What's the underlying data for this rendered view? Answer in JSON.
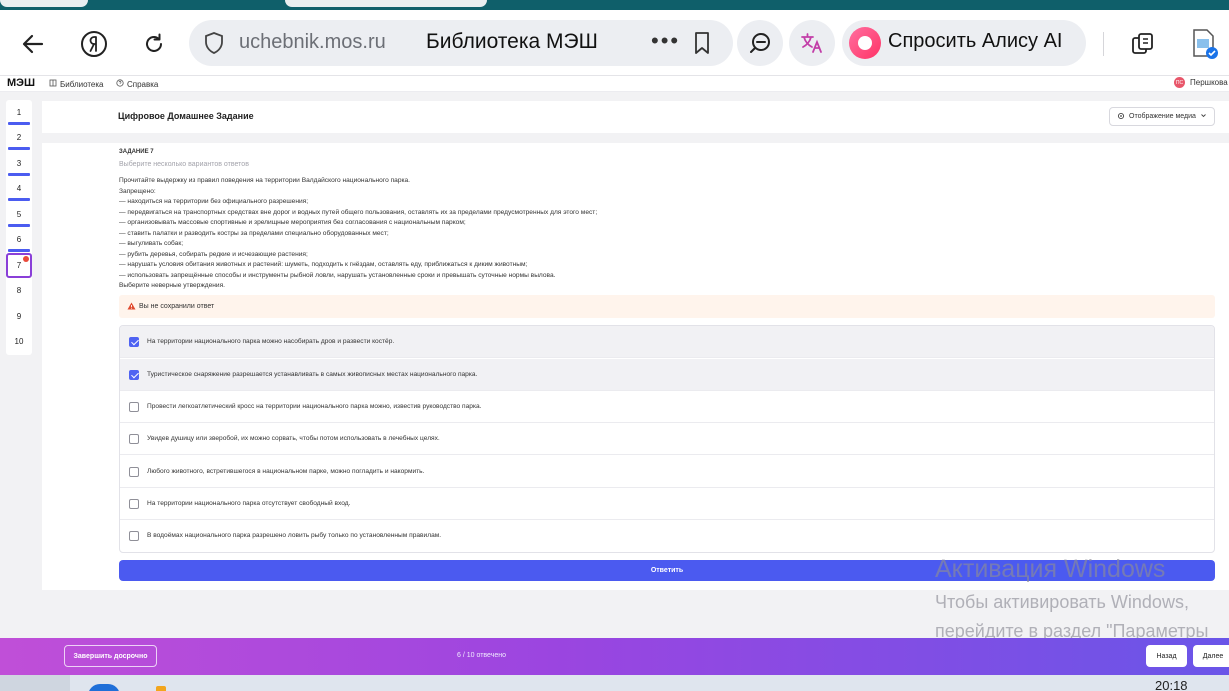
{
  "browser": {
    "host": "uchebnik.mos.ru",
    "page_title": "Библиотека МЭШ",
    "more": "•••",
    "alice_label": "Спросить Алису AI"
  },
  "site_header": {
    "logo": "МЭШ",
    "nav": [
      {
        "label": "Библиотека",
        "icon": "book-icon"
      },
      {
        "label": "Справка",
        "icon": "help-icon"
      }
    ],
    "user_name": "Першкова",
    "user_initials": "ПС"
  },
  "question_nav": [
    {
      "number": "1",
      "answered": true
    },
    {
      "number": "2",
      "answered": true
    },
    {
      "number": "3",
      "answered": true
    },
    {
      "number": "4",
      "answered": true
    },
    {
      "number": "5",
      "answered": true
    },
    {
      "number": "6",
      "answered": true
    },
    {
      "number": "7",
      "answered": false,
      "active": true,
      "warning": true
    },
    {
      "number": "8",
      "answered": false
    },
    {
      "number": "9",
      "answered": false
    },
    {
      "number": "10",
      "answered": false
    }
  ],
  "main": {
    "title": "Цифровое Домашнее Задание",
    "media_button": "Отображение медиа",
    "task_label": "ЗАДАНИЕ 7",
    "task_subtitle": "Выберите несколько вариантов ответов",
    "task_lines": [
      "Прочитайте выдержку из правил поведения на территории Валдайского национального парка.",
      "Запрещено:",
      "— находиться на территории без официального разрешения;",
      "— передвигаться на транспортных средствах вне дорог и водных путей общего пользования, оставлять их за пределами предусмотренных для этого мест;",
      "— организовывать массовые спортивные и зрелищные мероприятия без согласования с национальным парком;",
      "— ставить палатки и разводить костры за пределами специально оборудованных мест;",
      "— выгуливать собак;",
      "— рубить деревья, собирать редкие и исчезающие растения;",
      "— нарушать условия обитания животных и растений: шуметь, подходить к гнёздам, оставлять еду, приближаться к диким животным;",
      "— использовать запрещённые способы и инструменты рыбной ловли, нарушать установленные сроки и превышать суточные нормы вылова.",
      "Выберите неверные утверждения."
    ],
    "warning": "Вы не сохранили ответ",
    "options": [
      {
        "label": "На территории национального парка можно насобирать дров и развести костёр.",
        "checked": true
      },
      {
        "label": "Туристическое снаряжение разрешается устанавливать в самых живописных местах национального парка.",
        "checked": true
      },
      {
        "label": "Провести легкоатлетический кросс на территории национального парка можно, известив руководство парка.",
        "checked": false
      },
      {
        "label": "Увидев душицу или зверобой, их можно сорвать, чтобы потом использовать в лечебных целях.",
        "checked": false
      },
      {
        "label": "Любого животного, встретившегося в национальном парке, можно погладить и накормить.",
        "checked": false
      },
      {
        "label": "На территории национального парка отсутствует свободный вход.",
        "checked": false
      },
      {
        "label": "В водоёмах национального парка разрешено ловить рыбу только по установленным правилам.",
        "checked": false
      }
    ],
    "answer_button": "Ответить"
  },
  "watermark": {
    "line1": "Активация Windows",
    "line2": "Чтобы активировать Windows,",
    "line3": "перейдите в раздел \"Параметры"
  },
  "bottom_bar": {
    "finish_button": "Завершить досрочно",
    "progress": "6 / 10 отвечено",
    "progress_answered": 6,
    "progress_total": 10,
    "back_button": "Назад",
    "next_button": "Далее"
  },
  "taskbar": {
    "time": "20:18"
  },
  "colors": {
    "accent": "#4b5af0",
    "bottom_gradient_start": "#c04fd8",
    "bottom_gradient_end": "#6a55e8",
    "warning": "#ea4a3b"
  }
}
